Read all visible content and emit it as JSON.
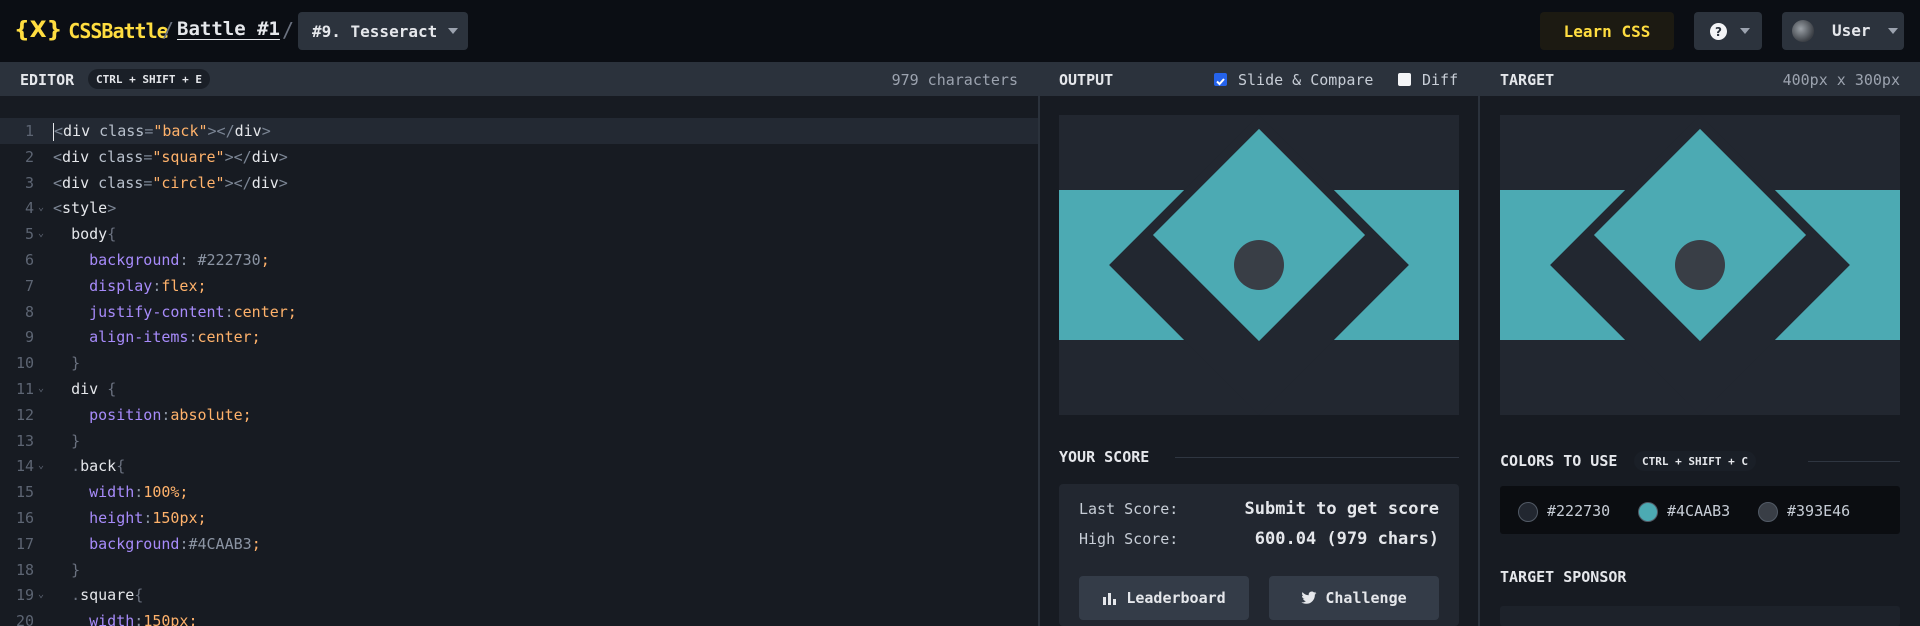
{
  "header": {
    "logo_mark": "{X}",
    "logo_text": "CSSBattle",
    "separator": "/",
    "battle_link": "Battle #1",
    "level_select": "#9. Tesseract",
    "learn_label": "Learn CSS",
    "help_glyph": "?",
    "user_label": "User"
  },
  "editor": {
    "title": "EDITOR",
    "shortcut": "CTRL + SHIFT + E",
    "char_count": "979 characters",
    "lines": [
      {
        "n": "1",
        "fold": false,
        "active": true,
        "tokens": [
          [
            "br",
            "<"
          ],
          [
            "tag",
            "div"
          ],
          [
            "sp",
            " "
          ],
          [
            "attr",
            "class"
          ],
          [
            "br",
            "="
          ],
          [
            "str",
            "\"back\""
          ],
          [
            "br",
            "></"
          ],
          [
            "tag",
            "div"
          ],
          [
            "br",
            ">"
          ]
        ]
      },
      {
        "n": "2",
        "fold": false,
        "tokens": [
          [
            "br",
            "<"
          ],
          [
            "tag",
            "div"
          ],
          [
            "sp",
            " "
          ],
          [
            "attr",
            "class"
          ],
          [
            "br",
            "="
          ],
          [
            "str",
            "\"square\""
          ],
          [
            "br",
            "></"
          ],
          [
            "tag",
            "div"
          ],
          [
            "br",
            ">"
          ]
        ]
      },
      {
        "n": "3",
        "fold": false,
        "tokens": [
          [
            "br",
            "<"
          ],
          [
            "tag",
            "div"
          ],
          [
            "sp",
            " "
          ],
          [
            "attr",
            "class"
          ],
          [
            "br",
            "="
          ],
          [
            "str",
            "\"circle\""
          ],
          [
            "br",
            "></"
          ],
          [
            "tag",
            "div"
          ],
          [
            "br",
            ">"
          ]
        ]
      },
      {
        "n": "4",
        "fold": true,
        "tokens": [
          [
            "br",
            "<"
          ],
          [
            "tag",
            "style"
          ],
          [
            "br",
            ">"
          ]
        ]
      },
      {
        "n": "5",
        "fold": true,
        "tokens": [
          [
            "sp",
            "  "
          ],
          [
            "sel",
            "body"
          ],
          [
            "punc",
            "{"
          ]
        ]
      },
      {
        "n": "6",
        "fold": false,
        "tokens": [
          [
            "sp",
            "    "
          ],
          [
            "prop",
            "background"
          ],
          [
            "col",
            ": "
          ],
          [
            "col",
            "#222730"
          ],
          [
            "val",
            ";"
          ]
        ]
      },
      {
        "n": "7",
        "fold": false,
        "tokens": [
          [
            "sp",
            "    "
          ],
          [
            "prop",
            "display"
          ],
          [
            "col",
            ":"
          ],
          [
            "val",
            "flex;"
          ]
        ]
      },
      {
        "n": "8",
        "fold": false,
        "tokens": [
          [
            "sp",
            "    "
          ],
          [
            "prop",
            "justify-content"
          ],
          [
            "col",
            ":"
          ],
          [
            "val",
            "center;"
          ]
        ]
      },
      {
        "n": "9",
        "fold": false,
        "tokens": [
          [
            "sp",
            "    "
          ],
          [
            "prop",
            "align-items"
          ],
          [
            "col",
            ":"
          ],
          [
            "val",
            "center;"
          ]
        ]
      },
      {
        "n": "10",
        "fold": false,
        "tokens": [
          [
            "sp",
            "  "
          ],
          [
            "punc",
            "}"
          ]
        ]
      },
      {
        "n": "11",
        "fold": true,
        "tokens": [
          [
            "sp",
            "  "
          ],
          [
            "sel",
            "div"
          ],
          [
            "sp",
            " "
          ],
          [
            "punc",
            "{"
          ]
        ]
      },
      {
        "n": "12",
        "fold": false,
        "tokens": [
          [
            "sp",
            "    "
          ],
          [
            "prop",
            "position"
          ],
          [
            "col",
            ":"
          ],
          [
            "val",
            "absolute;"
          ]
        ]
      },
      {
        "n": "13",
        "fold": false,
        "tokens": [
          [
            "sp",
            "  "
          ],
          [
            "punc",
            "}"
          ]
        ]
      },
      {
        "n": "14",
        "fold": true,
        "tokens": [
          [
            "sp",
            "  "
          ],
          [
            "punc",
            "."
          ],
          [
            "sel",
            "back"
          ],
          [
            "punc",
            "{"
          ]
        ]
      },
      {
        "n": "15",
        "fold": false,
        "tokens": [
          [
            "sp",
            "    "
          ],
          [
            "prop",
            "width"
          ],
          [
            "col",
            ":"
          ],
          [
            "num",
            "100"
          ],
          [
            "val",
            "%;"
          ]
        ]
      },
      {
        "n": "16",
        "fold": false,
        "tokens": [
          [
            "sp",
            "    "
          ],
          [
            "prop",
            "height"
          ],
          [
            "col",
            ":"
          ],
          [
            "num",
            "150"
          ],
          [
            "val",
            "px;"
          ]
        ]
      },
      {
        "n": "17",
        "fold": false,
        "tokens": [
          [
            "sp",
            "    "
          ],
          [
            "prop",
            "background"
          ],
          [
            "col",
            ":"
          ],
          [
            "col",
            "#4CAAB3"
          ],
          [
            "val",
            ";"
          ]
        ]
      },
      {
        "n": "18",
        "fold": false,
        "tokens": [
          [
            "sp",
            "  "
          ],
          [
            "punc",
            "}"
          ]
        ]
      },
      {
        "n": "19",
        "fold": true,
        "tokens": [
          [
            "sp",
            "  "
          ],
          [
            "punc",
            "."
          ],
          [
            "sel",
            "square"
          ],
          [
            "punc",
            "{"
          ]
        ]
      },
      {
        "n": "20",
        "fold": false,
        "tokens": [
          [
            "sp",
            "    "
          ],
          [
            "prop",
            "width"
          ],
          [
            "col",
            ":"
          ],
          [
            "num",
            "150"
          ],
          [
            "val",
            "px;"
          ]
        ]
      }
    ]
  },
  "output": {
    "title": "OUTPUT",
    "slide_compare": "Slide & Compare",
    "slide_compare_checked": true,
    "diff": "Diff",
    "diff_checked": false
  },
  "target": {
    "title": "TARGET",
    "size": "400px x 300px"
  },
  "score": {
    "title": "YOUR SCORE",
    "last_label": "Last Score:",
    "last_value": "Submit to get score",
    "high_label": "High Score:",
    "high_value": "600.04 (979 chars)",
    "leaderboard_label": "Leaderboard",
    "challenge_label": "Challenge"
  },
  "colors": {
    "title": "COLORS TO USE",
    "shortcut": "CTRL + SHIFT + C",
    "items": [
      {
        "label": "#222730",
        "hex": "#222730"
      },
      {
        "label": "#4CAAB3",
        "hex": "#4CAAB3"
      },
      {
        "label": "#393E46",
        "hex": "#393E46"
      }
    ]
  },
  "sponsor": {
    "title": "TARGET SPONSOR"
  },
  "theme": {
    "accent": "#ffdd40",
    "teal": "#4caab3",
    "bg": "#222730",
    "dot": "#393e46"
  }
}
